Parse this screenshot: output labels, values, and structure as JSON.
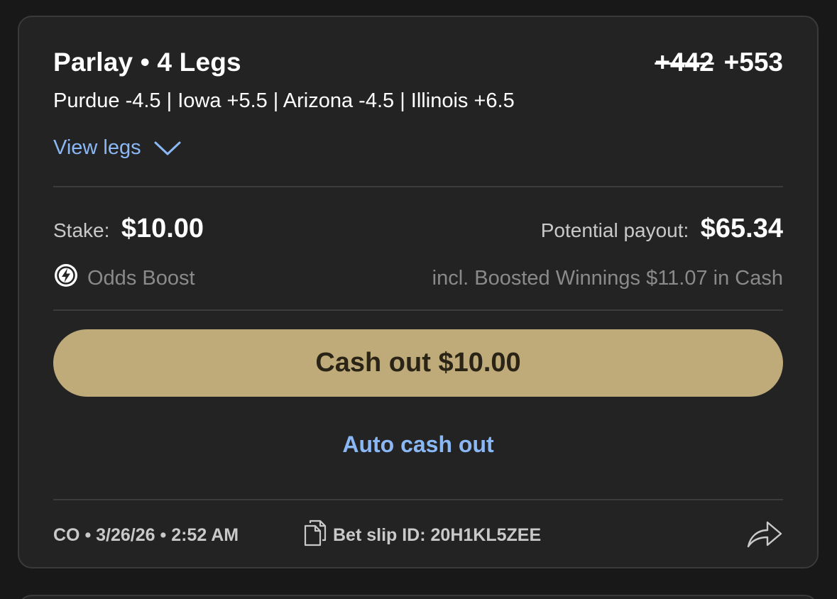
{
  "bet": {
    "title": "Parlay • 4 Legs",
    "odds_original": "+442",
    "odds_boosted": "+553",
    "legs_summary": "Purdue -4.5 | Iowa +5.5 | Arizona -4.5 | Illinois +6.5",
    "view_legs_label": "View legs",
    "stake_label": "Stake:",
    "stake_value": "$10.00",
    "payout_label": "Potential payout:",
    "payout_value": "$65.34",
    "boost_label": "Odds Boost",
    "boost_note": "incl. Boosted Winnings $11.07 in Cash",
    "cashout_label": "Cash out $10.00",
    "auto_cashout_label": "Auto cash out",
    "footer_meta": "CO • 3/26/26 • 2:52 AM",
    "bet_slip_label": "Bet slip ID: 20H1KL5ZEE"
  },
  "icons": {
    "chevron": "chevron-down-icon",
    "boost": "lightning-bolt-icon",
    "copy": "copy-document-icon",
    "share": "share-arrow-icon"
  },
  "colors": {
    "background": "#181818",
    "card": "#232323",
    "accent_link": "#8ab8f5",
    "cashout_button": "#bfaa79",
    "muted_text": "#8a8a8a"
  }
}
